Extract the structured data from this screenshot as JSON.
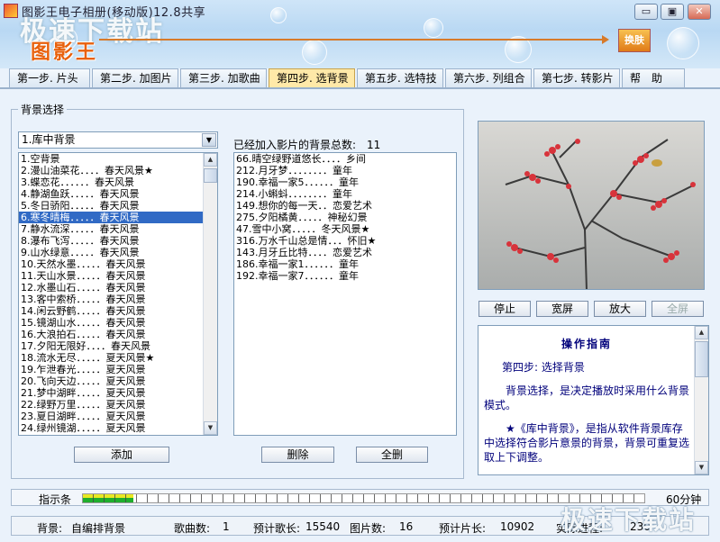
{
  "window": {
    "title": "图影王电子相册(移动版)12.8共享",
    "minimize": "▭",
    "restore": "▣",
    "close": "✕"
  },
  "banner": {
    "logo": "图影王",
    "skin_button": "换肤",
    "watermark": "极速下载站"
  },
  "tabs": [
    {
      "label": "第一步. 片头",
      "active": false
    },
    {
      "label": "第二步. 加图片",
      "active": false
    },
    {
      "label": "第三步. 加歌曲",
      "active": false
    },
    {
      "label": "第四步. 选背景",
      "active": true
    },
    {
      "label": "第五步. 选特技",
      "active": false
    },
    {
      "label": "第六步. 列组合",
      "active": false
    },
    {
      "label": "第七步. 转影片",
      "active": false
    },
    {
      "label": "帮　助",
      "active": false
    }
  ],
  "background_select": {
    "group_title": "背景选择",
    "dropdown_value": "1.库中背景",
    "library_list": [
      "1.空背景",
      "2.漫山油菜花．．．．春天风景★",
      "3.蝶恋花．．．．．．春天风景",
      "4.静湖鱼跃．．．．．春天风景",
      "5.冬日骄阳．．．．．春天风景",
      "6.寒冬晴梅．．．．．春天风景",
      "7.静水流深．．．．．春天风景",
      "8.瀑布飞泻．．．．．春天风景",
      "9.山水绿意．．．．．春天风景",
      "10.天然水墨．．．．．春天风景",
      "11.天山水景．．．．．春天风景",
      "12.水墨山石．．．．．春天风景",
      "13.客中索桥．．．．．春天风景",
      "14.闲云野鹤．．．．．春天风景",
      "15.镜湖山水．．．．．春天风景",
      "16.大浪拍石．．．．．春天风景",
      "17.夕阳无限好．．．．春天风景",
      "18.流水无尽．．．．．夏天风景★",
      "19.乍泄春光．．．．．夏天风景",
      "20.飞向天边．．．．．夏天风景",
      "21.梦中湖畔．．．．．夏天风景",
      "22.绿野万里．．．．．夏天风景",
      "23.夏日湖畔．．．．．夏天风景",
      "24.绿州镜湖．．．．．夏天风景"
    ],
    "selected_index": 5,
    "added_label": "已经加入影片的背景总数:",
    "added_count": "11",
    "added_list": [
      "66.晴空绿野道悠长．．．．乡间",
      "212.月牙梦．．．．．．．．童年",
      "190.幸福一家5．．．．．．童年",
      "214.小蝌蚪．．．．．．．．童年",
      "149.想你的每一天．．恋爱艺术",
      "275.夕阳橘黄．．．．．神秘幻景",
      "47.雪中小窝．．．．．冬天风景★",
      "316.万水千山总是情．．．怀旧★",
      "143.月牙丘比特．．．．恋爱艺术",
      "186.幸福一家1．．．．．．童年",
      "192.幸福一家7．．．．．．童年"
    ],
    "add_button": "添加",
    "delete_button": "删除",
    "delete_all_button": "全删"
  },
  "preview": {
    "stop_button": "停止",
    "widescreen_button": "宽屏",
    "zoom_button": "放大",
    "fullscreen_button": "全屏"
  },
  "guide": {
    "title": "操作指南",
    "step": "第四步: 选择背景",
    "para1": "背景选择，是决定播放时采用什么背景模式。",
    "para2": "★《库中背景》，是指从软件背景库存中选择符合影片意景的背景，背景可重复选取上下调整。"
  },
  "indicator": {
    "label": "指示条",
    "minutes": "60分钟",
    "progress_fraction": 0.09
  },
  "status": {
    "background_label": "背景:",
    "background_value": "自编排背景",
    "songs_label": "歌曲数:",
    "songs_value": "1",
    "song_length_label": "预计歌长:",
    "song_length_value": "15540",
    "images_label": "图片数:",
    "images_value": "16",
    "film_length_label": "预计片长:",
    "film_length_value": "10902",
    "progress_label": "实际进程:",
    "progress_value": "230"
  },
  "colors": {
    "selection": "#316ac5",
    "guide_text": "#00007b",
    "logo": "#e8600c",
    "active_tab": "#ffe9a8"
  }
}
